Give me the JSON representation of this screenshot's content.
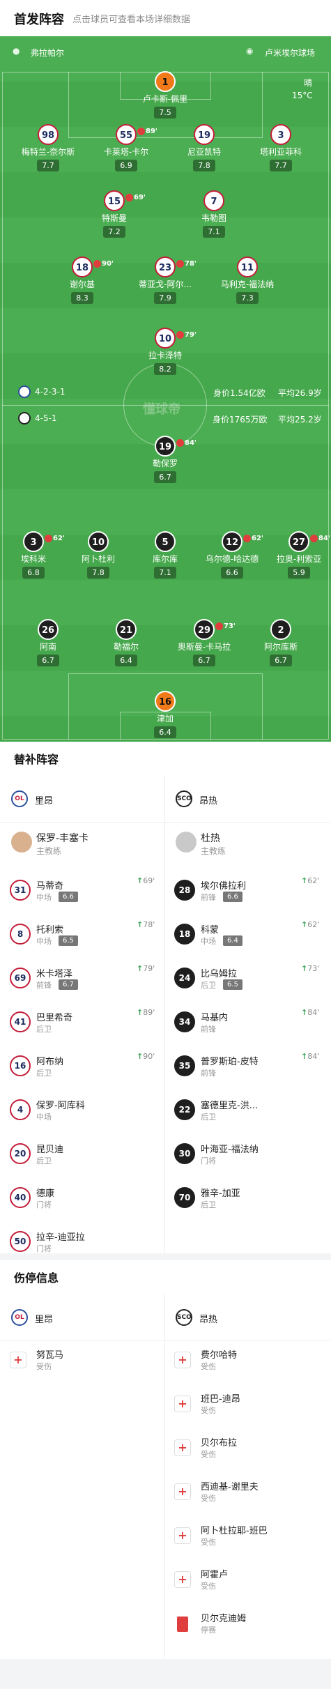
{
  "header": {
    "title": "首发阵容",
    "subtitle": "点击球员可查看本场详细数据"
  },
  "match_info": {
    "referee": "弗拉帕尔",
    "venue": "卢米埃尔球场",
    "weather": "晴",
    "temperature": "15°C",
    "watermark": "懂球帝"
  },
  "teams": {
    "home": {
      "name": "里昂",
      "formation": "4-2-3-1",
      "value": "身价1.54亿欧",
      "avg_age": "平均26.9岁",
      "badge": "OL"
    },
    "away": {
      "name": "昂热",
      "formation": "4-5-1",
      "value": "身价1765万欧",
      "avg_age": "平均25.2岁",
      "badge": "SCO"
    }
  },
  "home_players": [
    {
      "no": "1",
      "name": "卢卡斯-佩里",
      "rating": "7.5",
      "ev": ""
    },
    {
      "no": "98",
      "name": "梅特兰-奈尔斯",
      "rating": "7.7",
      "ev": ""
    },
    {
      "no": "55",
      "name": "卡莱塔-卡尔",
      "rating": "6.9",
      "ev": "89'"
    },
    {
      "no": "19",
      "name": "尼亚凯特",
      "rating": "7.8",
      "ev": ""
    },
    {
      "no": "3",
      "name": "塔利亚菲科",
      "rating": "7.7",
      "ev": ""
    },
    {
      "no": "15",
      "name": "特斯曼",
      "rating": "7.2",
      "ev": "69'"
    },
    {
      "no": "7",
      "name": "韦勒图",
      "rating": "7.1",
      "ev": ""
    },
    {
      "no": "18",
      "name": "谢尔基",
      "rating": "8.3",
      "ev": "90'"
    },
    {
      "no": "23",
      "name": "蒂亚戈-阿尔...",
      "rating": "7.9",
      "ev": "78'"
    },
    {
      "no": "11",
      "name": "马利克-福法纳",
      "rating": "7.3",
      "ev": ""
    },
    {
      "no": "10",
      "name": "拉卡泽特",
      "rating": "8.2",
      "ev": "79'"
    }
  ],
  "away_players": [
    {
      "no": "19",
      "name": "勒保罗",
      "rating": "6.7",
      "ev": "84'"
    },
    {
      "no": "3",
      "name": "埃科米",
      "rating": "6.8",
      "ev": "62'"
    },
    {
      "no": "10",
      "name": "阿卜杜利",
      "rating": "7.8",
      "ev": ""
    },
    {
      "no": "5",
      "name": "库尔库",
      "rating": "7.1",
      "ev": ""
    },
    {
      "no": "12",
      "name": "乌尔德-哈达德",
      "rating": "6.6",
      "ev": "62'"
    },
    {
      "no": "27",
      "name": "拉奥-利索亚",
      "rating": "5.9",
      "ev": "84'"
    },
    {
      "no": "26",
      "name": "阿南",
      "rating": "6.7",
      "ev": ""
    },
    {
      "no": "21",
      "name": "勒福尔",
      "rating": "6.4",
      "ev": ""
    },
    {
      "no": "29",
      "name": "奥斯曼-卡马拉",
      "rating": "6.7",
      "ev": "73'"
    },
    {
      "no": "2",
      "name": "阿尔库斯",
      "rating": "6.7",
      "ev": ""
    },
    {
      "no": "16",
      "name": "津加",
      "rating": "6.4",
      "ev": ""
    }
  ],
  "subs_section": {
    "title": "替补阵容",
    "home_coach": {
      "name": "保罗-丰塞卡",
      "role": "主教练"
    },
    "away_coach": {
      "name": "杜热",
      "role": "主教练"
    },
    "home": [
      {
        "no": "31",
        "name": "马蒂奇",
        "pos": "中场",
        "rating": "6.6",
        "in": "69'"
      },
      {
        "no": "8",
        "name": "托利索",
        "pos": "中场",
        "rating": "6.5",
        "in": "78'"
      },
      {
        "no": "69",
        "name": "米卡塔泽",
        "pos": "前锋",
        "rating": "6.7",
        "in": "79'"
      },
      {
        "no": "41",
        "name": "巴里希奇",
        "pos": "后卫",
        "rating": "",
        "in": "89'"
      },
      {
        "no": "16",
        "name": "阿布纳",
        "pos": "后卫",
        "rating": "",
        "in": "90'"
      },
      {
        "no": "4",
        "name": "保罗-阿库科",
        "pos": "中场",
        "rating": "",
        "in": ""
      },
      {
        "no": "20",
        "name": "昆贝迪",
        "pos": "后卫",
        "rating": "",
        "in": ""
      },
      {
        "no": "40",
        "name": "德康",
        "pos": "门将",
        "rating": "",
        "in": ""
      },
      {
        "no": "50",
        "name": "拉辛-迪亚拉",
        "pos": "门将",
        "rating": "",
        "in": ""
      }
    ],
    "away": [
      {
        "no": "28",
        "name": "埃尔佛拉利",
        "pos": "前锋",
        "rating": "6.6",
        "in": "62'"
      },
      {
        "no": "18",
        "name": "科蒙",
        "pos": "中场",
        "rating": "6.4",
        "in": "62'"
      },
      {
        "no": "24",
        "name": "比乌姆拉",
        "pos": "后卫",
        "rating": "6.5",
        "in": "73'"
      },
      {
        "no": "34",
        "name": "马基内",
        "pos": "前锋",
        "rating": "",
        "in": "84'"
      },
      {
        "no": "35",
        "name": "普罗斯珀-皮特",
        "pos": "前锋",
        "rating": "",
        "in": "84'"
      },
      {
        "no": "22",
        "name": "塞德里克-洪...",
        "pos": "后卫",
        "rating": "",
        "in": ""
      },
      {
        "no": "30",
        "name": "叶海亚-福法纳",
        "pos": "门将",
        "rating": "",
        "in": ""
      },
      {
        "no": "70",
        "name": "雅辛-加亚",
        "pos": "后卫",
        "rating": "",
        "in": ""
      }
    ]
  },
  "injury_section": {
    "title": "伤停信息",
    "home": [
      {
        "name": "努瓦马",
        "status": "受伤"
      }
    ],
    "away": [
      {
        "name": "费尔哈特",
        "status": "受伤"
      },
      {
        "name": "班巴-迪昂",
        "status": "受伤"
      },
      {
        "name": "贝尔布拉",
        "status": "受伤"
      },
      {
        "name": "西迪基-谢里夫",
        "status": "受伤"
      },
      {
        "name": "阿卜杜拉耶-班巴",
        "status": "受伤"
      },
      {
        "name": "阿霍卢",
        "status": "受伤"
      },
      {
        "name": "贝尔克迪姆",
        "status": "停赛"
      }
    ]
  },
  "colors": {
    "pitch": "#46a84c",
    "home_accent": "#c41e3a",
    "away_accent": "#1e1e1e",
    "gk": "#f07a1a",
    "sub_in": "#3aa35a",
    "card": "#e03e3e"
  }
}
